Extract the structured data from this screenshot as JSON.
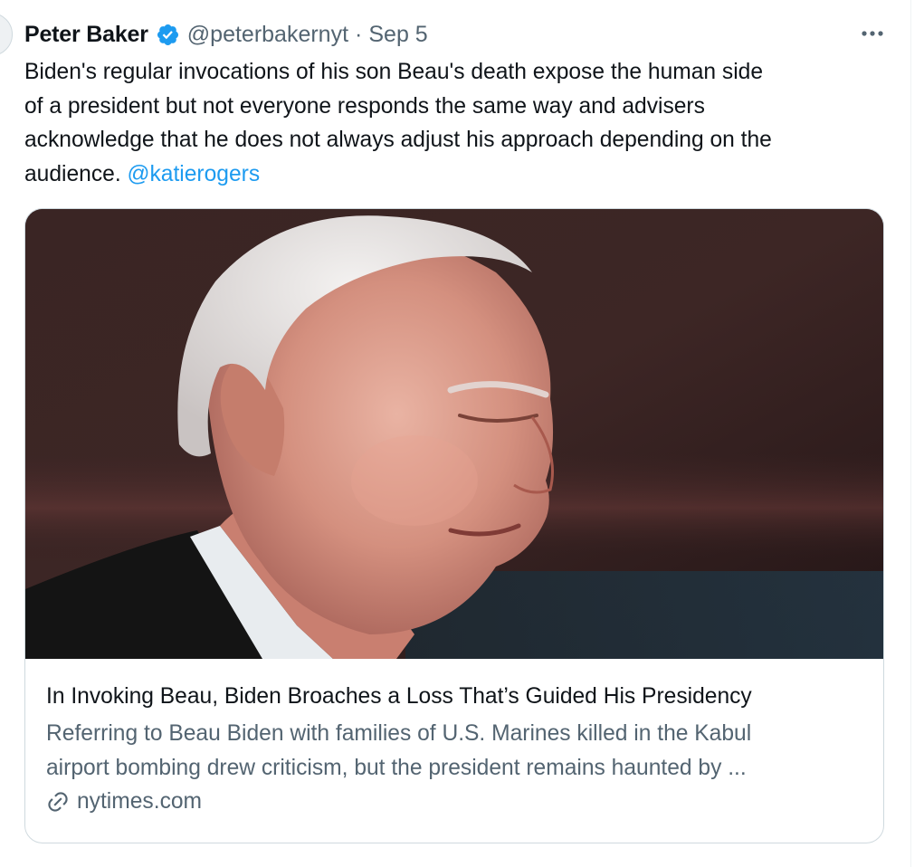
{
  "tweet": {
    "author_name": "Peter Baker",
    "verified_icon": "verified-badge-icon",
    "handle": "@peterbakernyt",
    "separator": "·",
    "date": "Sep 5",
    "more_icon": "more-options-icon",
    "text_lines": [
      "Biden's regular invocations of his son Beau's death expose the human side",
      "of a president but not everyone responds the same way and advisers",
      "acknowledge that he does not always adjust his approach depending on the"
    ],
    "text_last_line": "audience.",
    "mention": "@katierogers"
  },
  "card": {
    "image_description_icon": "article-photo",
    "title": "In Invoking Beau, Biden Broaches a Loss That’s Guided His Presidency",
    "description_lines": [
      "Referring to Beau Biden with families of U.S. Marines killed in the Kabul",
      "airport bombing drew criticism, but the president remains haunted by ..."
    ],
    "link_icon": "link-icon",
    "domain": "nytimes.com"
  },
  "colors": {
    "accent": "#1d9bf0",
    "text_primary": "#0f1419",
    "text_secondary": "#536471",
    "border": "#cfd9de"
  }
}
